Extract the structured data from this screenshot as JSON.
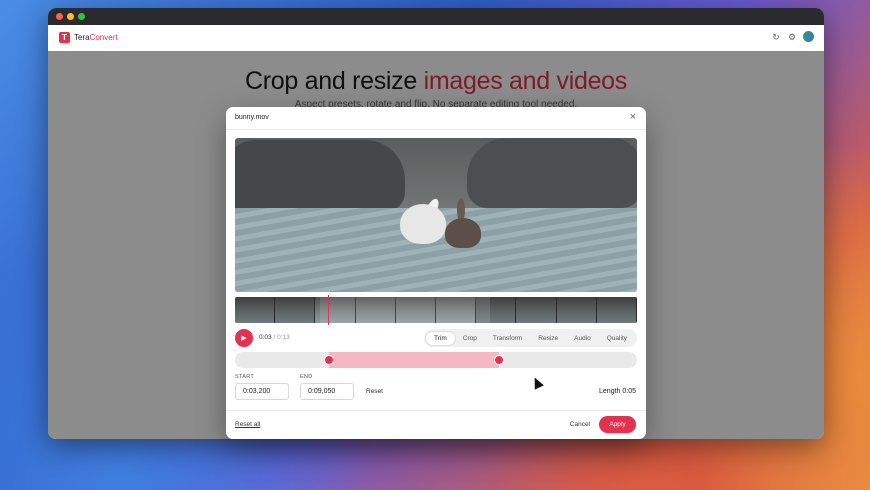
{
  "app": {
    "brand_prefix": "Tera",
    "brand_suffix": "Convert",
    "logo_letter": "T"
  },
  "hero": {
    "title_plain": "Crop and resize ",
    "title_accent": "images and videos",
    "subtitle": "Aspect presets, rotate and flip. No separate editing tool needed."
  },
  "modal": {
    "file_name": "bunny.mov",
    "close_icon": "×",
    "time_current": "0:03",
    "time_total": "0:13",
    "tabs": [
      "Trim",
      "Crop",
      "Transform",
      "Resize",
      "Audio",
      "Quality"
    ],
    "active_tab": "Trim",
    "start_label": "START",
    "start_value": "0:03,200",
    "end_label": "END",
    "end_value": "0:09,050",
    "reset_label": "Reset",
    "length_text": "Length 0:05",
    "reset_all_label": "Reset all",
    "cancel_label": "Cancel",
    "apply_label": "Apply"
  },
  "colors": {
    "accent": "#e3324f",
    "selection": "#f3b8c1"
  },
  "icons": {
    "refresh": "refresh-icon",
    "settings": "gear-icon",
    "play": "play-icon",
    "close": "close-icon"
  }
}
